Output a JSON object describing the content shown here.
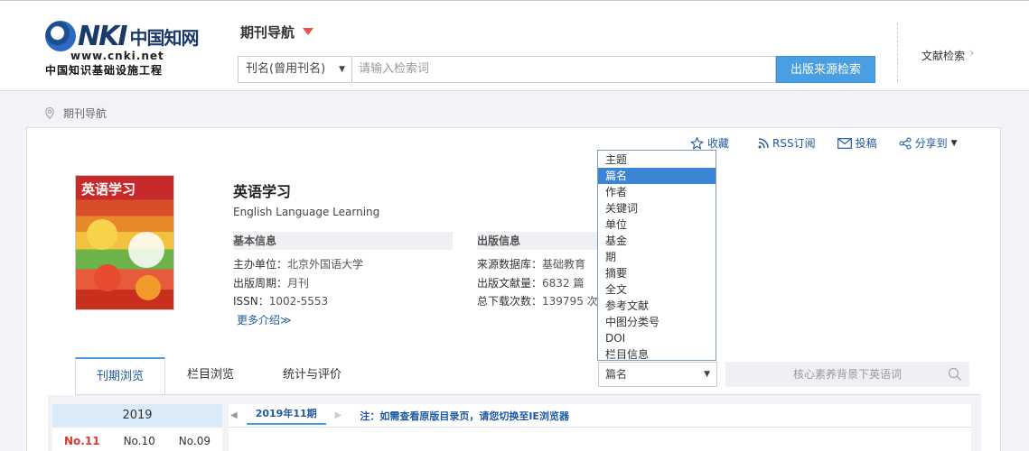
{
  "header": {
    "logo": {
      "brand": "CNKI",
      "cn_name": "中国知网",
      "url_text": "www.cnki.net",
      "subtitle": "中国知识基础设施工程"
    },
    "nav_title": "期刊导航",
    "search": {
      "field_select_value": "刊名(曾用刊名)",
      "input_placeholder": "请输入检索词",
      "button_label": "出版来源检索"
    },
    "literature_search_label": "文献检索"
  },
  "breadcrumb": {
    "label": "期刊导航"
  },
  "actions": {
    "favorite": "收藏",
    "rss": "RSS订阅",
    "submit": "投稿",
    "share": "分享到"
  },
  "journal": {
    "cover_title": "英语学习",
    "title": "英语学习",
    "english_title": "English Language Learning",
    "basic_info_heading": "基本信息",
    "publish_info_heading": "出版信息",
    "sponsor_label": "主办单位：",
    "sponsor": "北京外国语大学",
    "cycle_label": "出版周期：",
    "cycle": "月刊",
    "issn_label": "ISSN：",
    "issn": "1002-5553",
    "database_label": "来源数据库：",
    "database": "基础教育",
    "articles_label": "出版文献量：",
    "articles": "6832 篇",
    "downloads_label": "总下载次数：",
    "downloads": "139795 次",
    "more_intro": "更多介绍≫"
  },
  "tabs": [
    {
      "label": "刊期浏览",
      "active": true
    },
    {
      "label": "栏目浏览",
      "active": false
    },
    {
      "label": "统计与评价",
      "active": false
    }
  ],
  "in_journal_search": {
    "field_value": "篇名",
    "input_placeholder": "核心素养背景下英语词"
  },
  "dropdown_options": [
    "主题",
    "篇名",
    "作者",
    "关键词",
    "单位",
    "基金",
    "期",
    "摘要",
    "全文",
    "参考文献",
    "中图分类号",
    "DOI",
    "栏目信息"
  ],
  "dropdown_selected": "篇名",
  "issues": {
    "year": "2019",
    "list": [
      "No.11",
      "No.10",
      "No.09"
    ],
    "active": "No.11",
    "current_issue_tab": "2019年11期",
    "ie_note": "注：如需查看原版目录页，请您切换至IE浏览器"
  },
  "colors": {
    "accent": "#4a9ee2",
    "link": "#1f5ba0",
    "active_issue": "#d83a2e",
    "dropdown_selected": "#3a86d4"
  }
}
